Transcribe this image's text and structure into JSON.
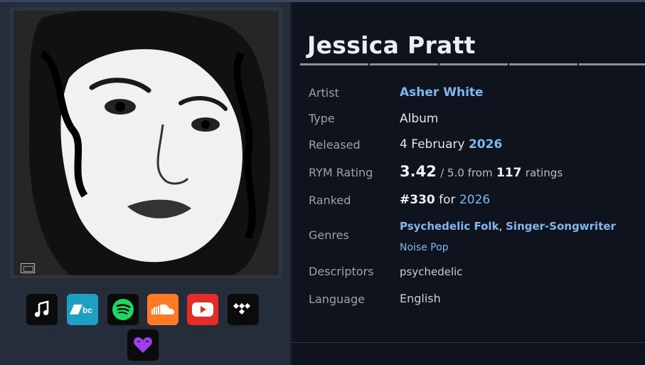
{
  "album": {
    "title": "Jessica Pratt"
  },
  "details": {
    "artist": {
      "label": "Artist",
      "value": "Asher White"
    },
    "type": {
      "label": "Type",
      "value": "Album"
    },
    "released": {
      "label": "Released",
      "day_month": "4 February",
      "year": "2026"
    },
    "rating": {
      "label": "RYM Rating",
      "score": "3.42",
      "out_of": "/ 5.0 from",
      "count": "117",
      "count_suffix": "ratings"
    },
    "ranked": {
      "label": "Ranked",
      "hash": "#",
      "rank": "330",
      "for_text": "for",
      "year": "2026"
    },
    "genres": {
      "label": "Genres",
      "primary_1": "Psychedelic Folk",
      "sep": ",",
      "primary_2": "Singer-Songwriter",
      "secondary": "Noise Pop"
    },
    "descriptors": {
      "label": "Descriptors",
      "value": "psychedelic"
    },
    "language": {
      "label": "Language",
      "value": "English"
    }
  },
  "streaming": [
    {
      "name": "apple-music-icon",
      "bg": "#0b0b0b",
      "fg": "#ffffff"
    },
    {
      "name": "bandcamp-icon",
      "bg": "#1da0c3",
      "fg": "#ffffff",
      "text": "bc"
    },
    {
      "name": "spotify-icon",
      "bg": "#0b0b0b",
      "fg": "#1ed760"
    },
    {
      "name": "soundcloud-icon",
      "bg": "#ff7a22",
      "fg": "#ffffff"
    },
    {
      "name": "youtube-icon",
      "bg": "#e52d27",
      "fg": "#ffffff"
    },
    {
      "name": "tidal-icon",
      "bg": "#0b0b0b",
      "fg": "#ffffff"
    },
    {
      "name": "heart-icon",
      "bg": "#0b0b0b",
      "fg": "#a23df0"
    }
  ],
  "colors": {
    "accent_link": "#7fb7f0",
    "panel_left": "#252d3b",
    "panel_right": "#0f131d"
  }
}
